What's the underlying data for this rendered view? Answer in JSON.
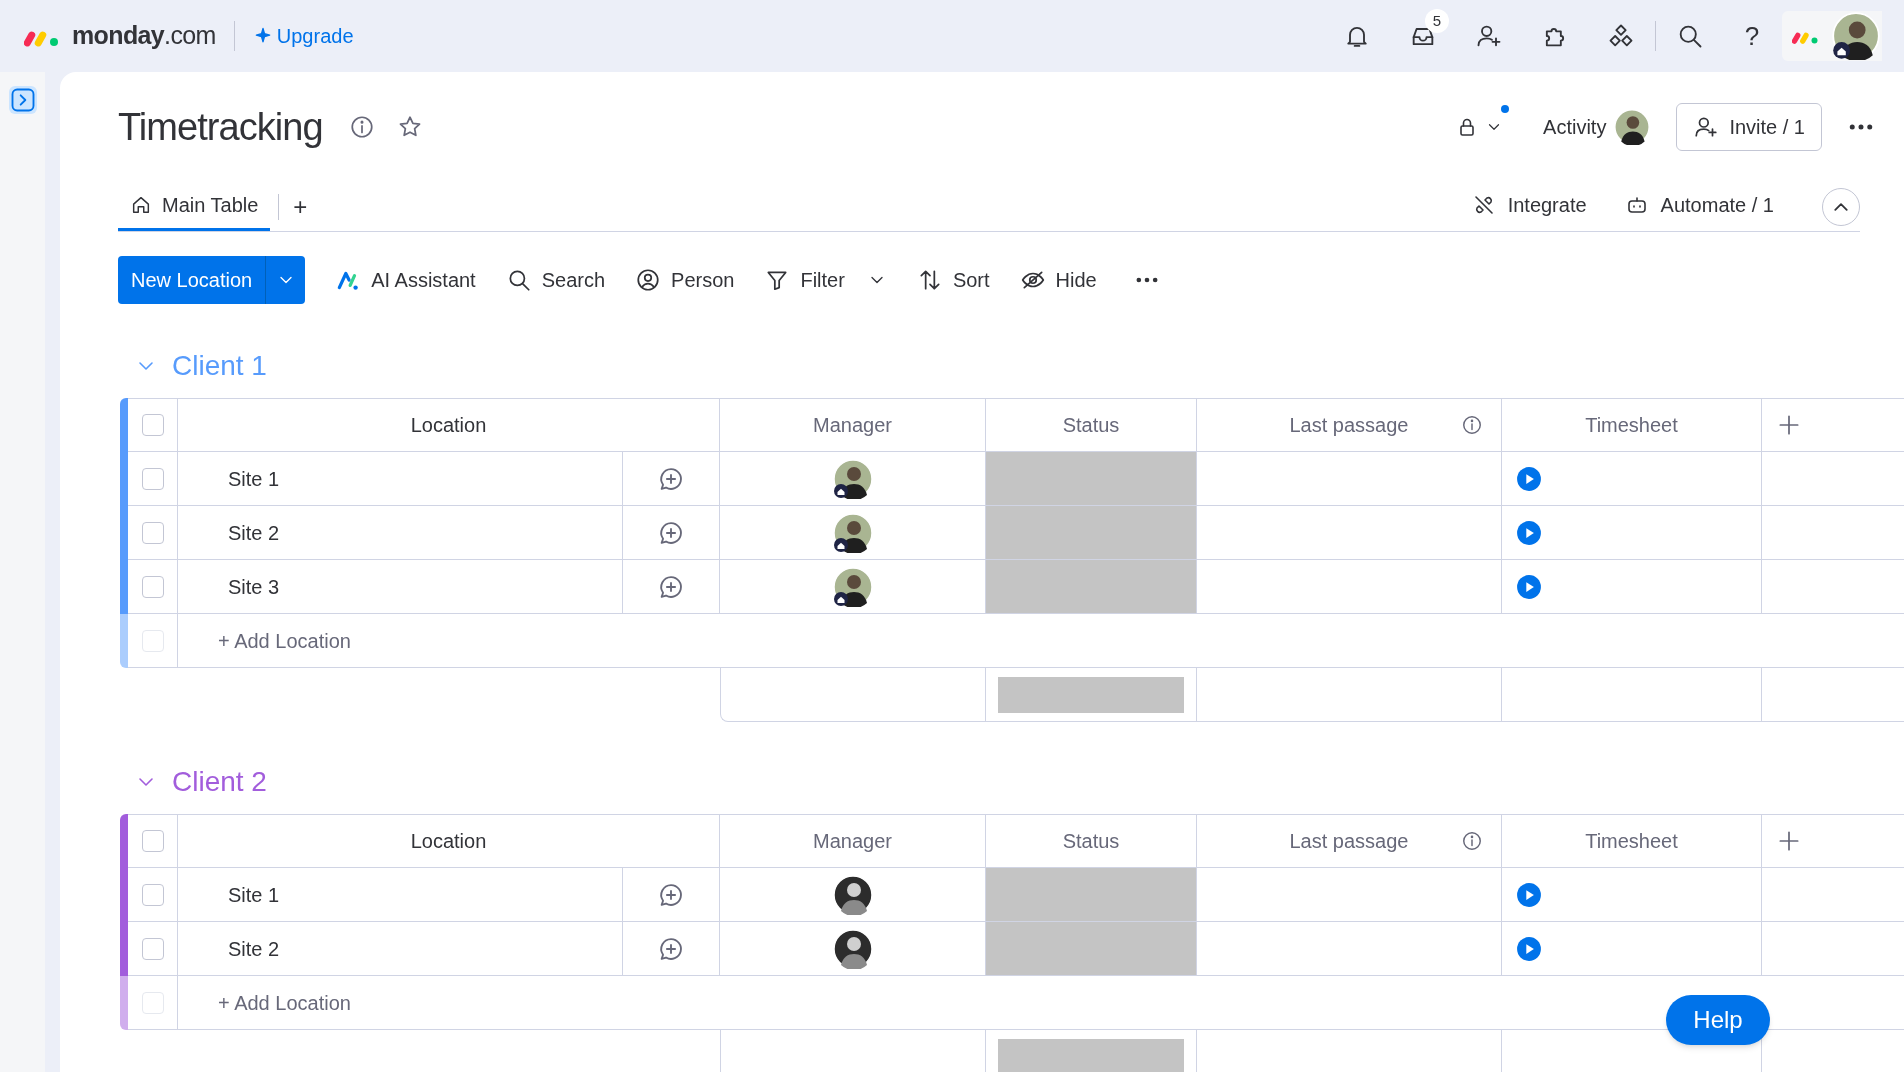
{
  "topbar": {
    "logo": "monday",
    "logo_suffix": ".com",
    "upgrade": "Upgrade",
    "inbox_count": "5",
    "help": "?"
  },
  "board": {
    "title": "Timetracking",
    "activity": "Activity",
    "invite": "Invite / 1",
    "tabs": [
      {
        "label": "Main Table",
        "selected": true
      }
    ],
    "add_view": "+",
    "integrate": "Integrate",
    "automate": "Automate / 1"
  },
  "toolbar": {
    "primary": "New Location",
    "items": [
      {
        "kind": "ai",
        "label": "AI Assistant",
        "dropdown": false
      },
      {
        "kind": "search",
        "label": "Search",
        "dropdown": false
      },
      {
        "kind": "person",
        "label": "Person",
        "dropdown": false
      },
      {
        "kind": "filter",
        "label": "Filter",
        "dropdown": true
      },
      {
        "kind": "sort",
        "label": "Sort",
        "dropdown": false
      },
      {
        "kind": "hide",
        "label": "Hide",
        "dropdown": false
      }
    ]
  },
  "groups": [
    {
      "name": "Client 1",
      "color": "#579bfc",
      "all_checked": false,
      "add_row_disabled": true,
      "columns": [
        "Location",
        "Manager",
        "Status",
        "Last passage",
        "Timesheet"
      ],
      "add_label": "+ Add Location",
      "rows": [
        {
          "checked": false,
          "location": "Site 1",
          "manager": {
            "badge": true,
            "monochrome": false
          }
        },
        {
          "checked": false,
          "location": "Site 2",
          "manager": {
            "badge": true,
            "monochrome": false
          }
        },
        {
          "checked": false,
          "location": "Site 3",
          "manager": {
            "badge": true,
            "monochrome": false
          }
        }
      ]
    },
    {
      "name": "Client 2",
      "color": "#a25ddc",
      "all_checked": false,
      "add_row_disabled": true,
      "columns": [
        "Location",
        "Manager",
        "Status",
        "Last passage",
        "Timesheet"
      ],
      "add_label": "+ Add Location",
      "rows": [
        {
          "checked": false,
          "location": "Site 1",
          "manager": {
            "badge": false,
            "monochrome": true
          }
        },
        {
          "checked": false,
          "location": "Site 2",
          "manager": {
            "badge": false,
            "monochrome": true
          }
        }
      ]
    }
  ],
  "help_button": "Help"
}
